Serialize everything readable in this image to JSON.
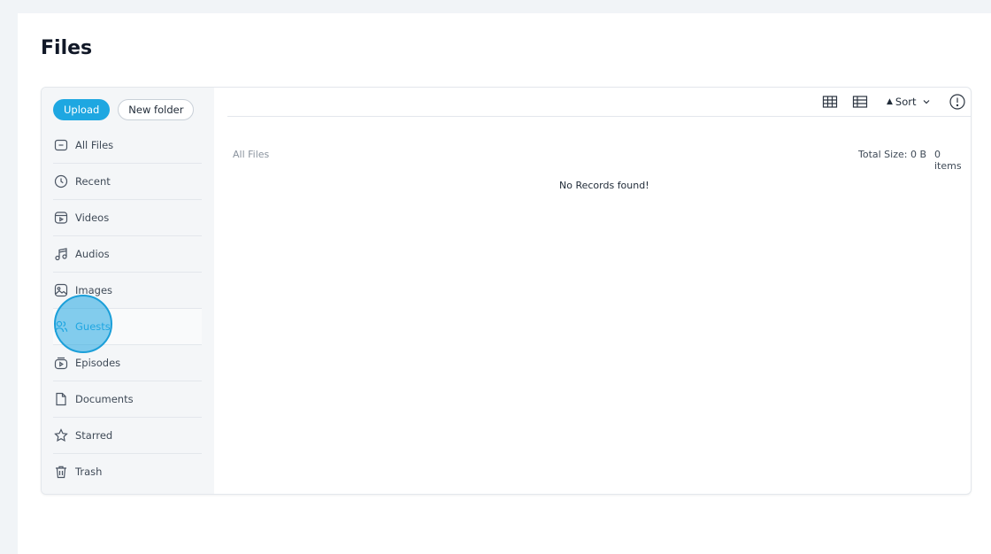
{
  "page": {
    "title": "Files"
  },
  "sidebar": {
    "upload_label": "Upload",
    "new_folder_label": "New folder",
    "items": [
      {
        "label": "All Files",
        "icon": "folder-icon"
      },
      {
        "label": "Recent",
        "icon": "clock-icon"
      },
      {
        "label": "Videos",
        "icon": "video-icon"
      },
      {
        "label": "Audios",
        "icon": "music-note-icon"
      },
      {
        "label": "Images",
        "icon": "image-icon"
      },
      {
        "label": "Guests",
        "icon": "users-icon",
        "active": true
      },
      {
        "label": "Episodes",
        "icon": "episode-icon"
      },
      {
        "label": "Documents",
        "icon": "document-icon"
      },
      {
        "label": "Starred",
        "icon": "star-icon"
      },
      {
        "label": "Trash",
        "icon": "trash-icon"
      }
    ]
  },
  "toolbar": {
    "sort_label": "Sort",
    "grid_view_icon": "grid-view-icon",
    "list_view_icon": "list-view-icon",
    "info_icon": "info-icon"
  },
  "content": {
    "breadcrumb": "All Files",
    "total_size": "Total Size: 0 B",
    "item_count": "0 items",
    "empty_message": "No Records found!"
  },
  "colors": {
    "accent": "#1ea7e1",
    "page_bg": "#f1f4f7",
    "sidebar_bg": "#f4f6f8",
    "border": "#e3e7ec"
  }
}
